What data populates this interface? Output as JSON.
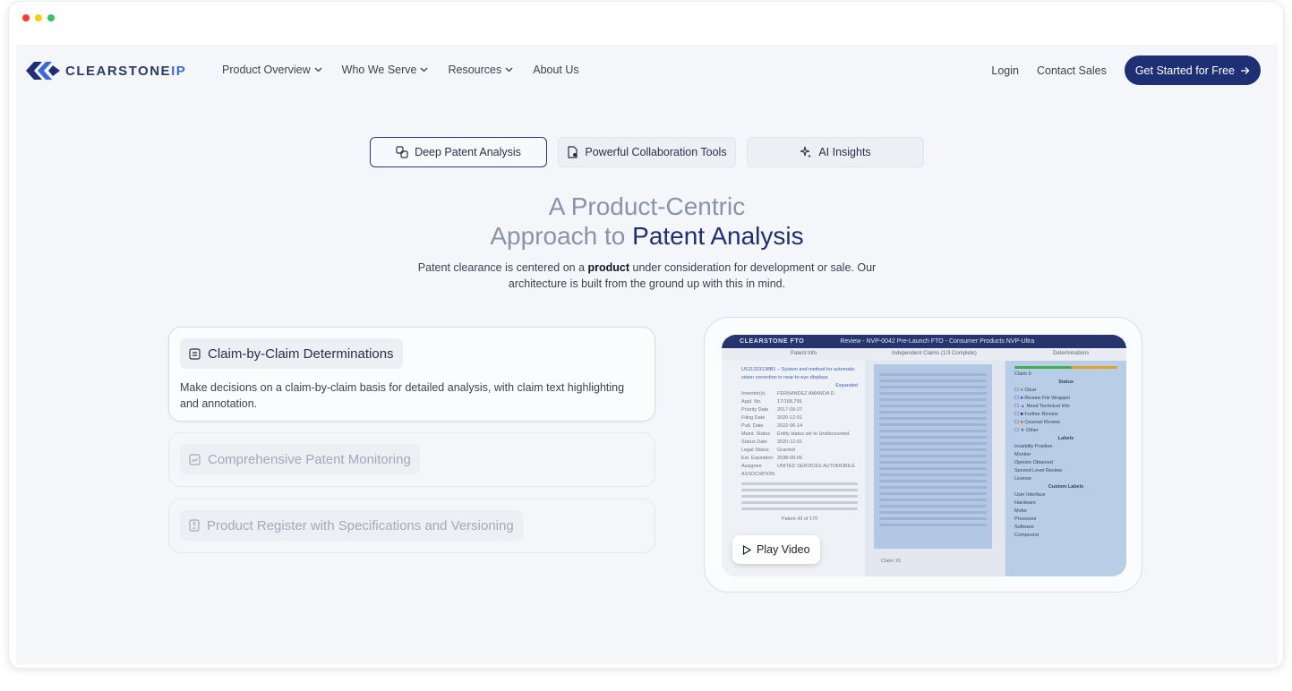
{
  "window": {
    "dot_colors": [
      "#ff3b30",
      "#ffcc00",
      "#34c759"
    ]
  },
  "brand": {
    "name_main": "CLEARSTONE",
    "name_accent": "IP",
    "color": "#1e2f73",
    "accent": "#3b6ad8"
  },
  "nav": {
    "links": [
      {
        "label": "Product Overview",
        "has_dropdown": true
      },
      {
        "label": "Who We Serve",
        "has_dropdown": true
      },
      {
        "label": "Resources",
        "has_dropdown": true
      },
      {
        "label": "About Us",
        "has_dropdown": false
      }
    ],
    "login": "Login",
    "contact": "Contact Sales",
    "cta": "Get Started for Free"
  },
  "tabs": [
    {
      "label": "Deep Patent Analysis",
      "icon": "patent-analysis-icon",
      "active": true
    },
    {
      "label": "Powerful Collaboration Tools",
      "icon": "collaboration-icon",
      "active": false
    },
    {
      "label": "AI Insights",
      "icon": "sparkle-icon",
      "active": false
    }
  ],
  "hero": {
    "title_line1": "A Product-Centric",
    "title_line2_muted": "Approach to ",
    "title_line2_strong": "Patent Analysis",
    "subtitle_before": "Patent clearance is centered on a ",
    "subtitle_bold": "product",
    "subtitle_after": " under consideration for development or sale. Our",
    "subtitle_line2": "architecture is built from the ground up with this in mind."
  },
  "features": [
    {
      "title": "Claim-by-Claim Determinations",
      "description": "Make decisions on a claim-by-claim basis for detailed analysis, with claim text highlighting and annotation.",
      "active": true
    },
    {
      "title": "Comprehensive Patent Monitoring",
      "description": "",
      "active": false
    },
    {
      "title": "Product Register with Specifications and Versioning",
      "description": "",
      "active": false
    }
  ],
  "preview": {
    "app_name": "CLEARSTONE FTO",
    "window_title": "Review - NVP-0042 Pre-Launch FTO - Consumer Products NVP-Ultra",
    "panel_left": "Patent Info",
    "panel_middle": "Independent Claims (1/3 Complete)",
    "panel_right": "Determinations",
    "patent_number": "US11333138B1",
    "patent_title": "System and method for automatic vision correction in near-to-eye displays",
    "status": "Expanded",
    "fields": [
      {
        "k": "Inventor(s)",
        "v": "FERNANDEZ AMANDA D."
      },
      {
        "k": "Appl. No.",
        "v": "17/168,795"
      },
      {
        "k": "Priority Date",
        "v": "2017-09-27"
      },
      {
        "k": "Filing Date",
        "v": "2020-12-01"
      },
      {
        "k": "Pub. Date",
        "v": "2022-06-14"
      },
      {
        "k": "Maint. Status",
        "v": "Entity status set to Undiscounted"
      },
      {
        "k": "Status Date",
        "v": "2020-12-01"
      },
      {
        "k": "Legal Status",
        "v": "Granted"
      },
      {
        "k": "Est. Expiration",
        "v": "2038-09-05"
      },
      {
        "k": "Assignee",
        "v": "UNITED SERVICES AUTOMOBILE ASSOCIATION"
      }
    ],
    "claim_label": "Claim 19",
    "pager": "Patent 43 of 170",
    "determination_claim": "Claim 9",
    "status_heading": "Status",
    "status_options": [
      "Clear",
      "Review File Wrapper",
      "Need Technical Info",
      "Further Review",
      "Counsel Review",
      "Other"
    ],
    "labels_heading": "Labels",
    "label_options": [
      "Invalidity Position",
      "Monitor",
      "Opinion Obtained",
      "Second Level Review",
      "License"
    ],
    "custom_heading": "Custom Labels",
    "custom_options": [
      "User Interface",
      "Hardware",
      "Motor",
      "Processor",
      "Software",
      "Compound"
    ],
    "play_label": "Play Video"
  }
}
